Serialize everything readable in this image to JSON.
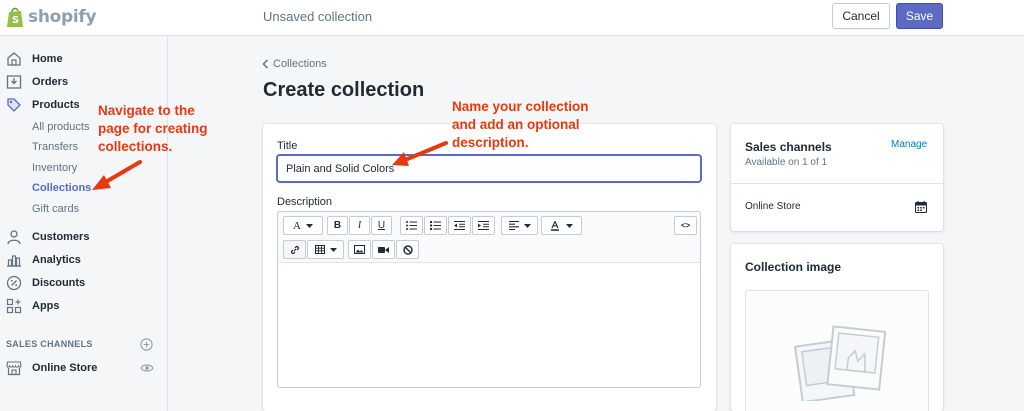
{
  "app": {
    "logo_text": "shopify"
  },
  "topbar": {
    "title": "Unsaved collection",
    "cancel_label": "Cancel",
    "save_label": "Save"
  },
  "sidebar": {
    "items": [
      {
        "label": "Home",
        "icon": "home-icon"
      },
      {
        "label": "Orders",
        "icon": "orders-icon"
      },
      {
        "label": "Products",
        "icon": "tag-icon"
      }
    ],
    "product_subitems": [
      "All products",
      "Transfers",
      "Inventory",
      "Collections",
      "Gift cards"
    ],
    "active_subitem": "Collections",
    "more_items": [
      {
        "label": "Customers",
        "icon": "person-icon"
      },
      {
        "label": "Analytics",
        "icon": "bar-chart-icon"
      },
      {
        "label": "Discounts",
        "icon": "discount-icon"
      },
      {
        "label": "Apps",
        "icon": "apps-icon"
      }
    ],
    "sales_channels_heading": "SALES CHANNELS",
    "online_store_label": "Online Store"
  },
  "breadcrumb": {
    "label": "Collections"
  },
  "page": {
    "title": "Create collection"
  },
  "form": {
    "title_label": "Title",
    "title_value": "Plain and Solid Colors",
    "description_label": "Description",
    "toolbar": {
      "font": "A",
      "bold": "B",
      "italic": "I",
      "underline": "U",
      "code": "<>"
    }
  },
  "sales_channels": {
    "title": "Sales channels",
    "available": "Available on 1 of 1",
    "manage_label": "Manage",
    "channel": "Online Store"
  },
  "collection_image": {
    "title": "Collection image"
  },
  "annotations": {
    "nav": "Navigate to the\npage for creating\ncollections.",
    "name": "Name your collection\nand add an optional\ndescription."
  },
  "colors": {
    "accent": "#5c6ac4",
    "link": "#007ace",
    "annotation": "#e8380d"
  }
}
